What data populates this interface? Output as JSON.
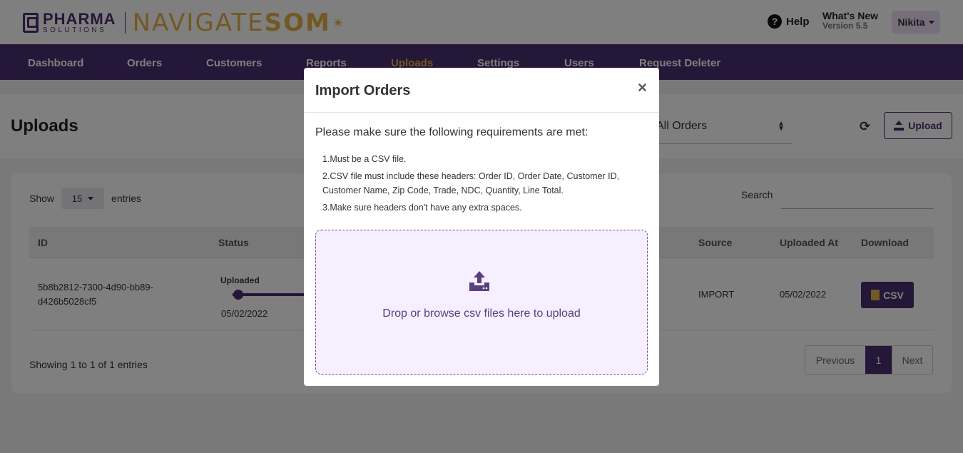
{
  "header": {
    "logo_pharma": "PHARMA",
    "logo_solutions": "SOLUTIONS",
    "logo_navigate": "NAVIGATE",
    "logo_som": "SOM",
    "help_label": "Help",
    "whats_new": "What's New",
    "version": "Version 5.5",
    "user_name": "Nikita"
  },
  "nav": {
    "items": [
      "Dashboard",
      "Orders",
      "Customers",
      "Reports",
      "Uploads",
      "Settings",
      "Users",
      "Request Deleter"
    ],
    "active": "Uploads"
  },
  "page": {
    "title": "Uploads",
    "filter_value": "All Orders",
    "upload_label": "Upload"
  },
  "table": {
    "show_label": "Show",
    "entries_value": "15",
    "entries_label": "entries",
    "search_label": "Search",
    "columns": [
      "ID",
      "Status",
      "Source",
      "Uploaded At",
      "Download"
    ],
    "rows": [
      {
        "id_line1": "5b8b2812-7300-4d90-bb89-",
        "id_line2": "d426b5028cf5",
        "status": "Uploaded",
        "status_date": "05/02/2022",
        "source": "IMPORT",
        "uploaded_at": "05/02/2022",
        "download_label": "CSV"
      }
    ],
    "showing_text": "Showing 1 to 1 of 1 entries",
    "pagination": {
      "previous": "Previous",
      "current": "1",
      "next": "Next"
    }
  },
  "modal": {
    "title": "Import Orders",
    "close": "×",
    "intro": "Please make sure the following requirements are met:",
    "requirements": [
      "1.Must be a CSV file.",
      "2.CSV file must include these headers: Order ID, Order Date, Customer ID, Customer Name, Zip Code, Trade, NDC, Quantity, Line Total.",
      "3.Make sure headers don't have any extra spaces."
    ],
    "drop_text": "Drop or browse csv files here to upload"
  },
  "colors": {
    "brand_purple": "#4b2e6e",
    "brand_gold": "#e5b044",
    "drop_bg": "#f5efff"
  }
}
